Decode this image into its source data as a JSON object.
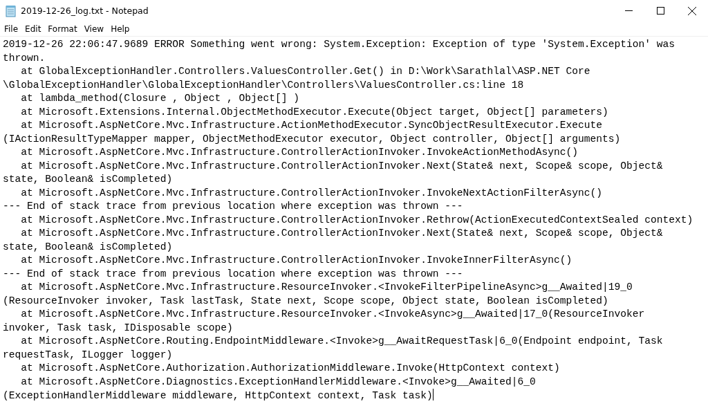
{
  "window": {
    "title": "2019-12-26_log.txt - Notepad"
  },
  "menu": [
    "File",
    "Edit",
    "Format",
    "View",
    "Help"
  ],
  "lines": [
    "2019-12-26 22:06:47.9689 ERROR Something went wrong: System.Exception: Exception of type 'System.Exception' was",
    "thrown.",
    "   at GlobalExceptionHandler.Controllers.ValuesController.Get() in D:\\Work\\Sarathlal\\ASP.NET Core",
    "\\GlobalExceptionHandler\\GlobalExceptionHandler\\Controllers\\ValuesController.cs:line 18",
    "   at lambda_method(Closure , Object , Object[] )",
    "   at Microsoft.Extensions.Internal.ObjectMethodExecutor.Execute(Object target, Object[] parameters)",
    "   at Microsoft.AspNetCore.Mvc.Infrastructure.ActionMethodExecutor.SyncObjectResultExecutor.Execute",
    "(IActionResultTypeMapper mapper, ObjectMethodExecutor executor, Object controller, Object[] arguments)",
    "   at Microsoft.AspNetCore.Mvc.Infrastructure.ControllerActionInvoker.InvokeActionMethodAsync()",
    "   at Microsoft.AspNetCore.Mvc.Infrastructure.ControllerActionInvoker.Next(State& next, Scope& scope, Object&",
    "state, Boolean& isCompleted)",
    "   at Microsoft.AspNetCore.Mvc.Infrastructure.ControllerActionInvoker.InvokeNextActionFilterAsync()",
    "--- End of stack trace from previous location where exception was thrown ---",
    "   at Microsoft.AspNetCore.Mvc.Infrastructure.ControllerActionInvoker.Rethrow(ActionExecutedContextSealed context)",
    "   at Microsoft.AspNetCore.Mvc.Infrastructure.ControllerActionInvoker.Next(State& next, Scope& scope, Object&",
    "state, Boolean& isCompleted)",
    "   at Microsoft.AspNetCore.Mvc.Infrastructure.ControllerActionInvoker.InvokeInnerFilterAsync()",
    "--- End of stack trace from previous location where exception was thrown ---",
    "   at Microsoft.AspNetCore.Mvc.Infrastructure.ResourceInvoker.<InvokeFilterPipelineAsync>g__Awaited|19_0",
    "(ResourceInvoker invoker, Task lastTask, State next, Scope scope, Object state, Boolean isCompleted)",
    "   at Microsoft.AspNetCore.Mvc.Infrastructure.ResourceInvoker.<InvokeAsync>g__Awaited|17_0(ResourceInvoker",
    "invoker, Task task, IDisposable scope)",
    "   at Microsoft.AspNetCore.Routing.EndpointMiddleware.<Invoke>g__AwaitRequestTask|6_0(Endpoint endpoint, Task",
    "requestTask, ILogger logger)",
    "   at Microsoft.AspNetCore.Authorization.AuthorizationMiddleware.Invoke(HttpContext context)",
    "   at Microsoft.AspNetCore.Diagnostics.ExceptionHandlerMiddleware.<Invoke>g__Awaited|6_0",
    "(ExceptionHandlerMiddleware middleware, HttpContext context, Task task)"
  ]
}
